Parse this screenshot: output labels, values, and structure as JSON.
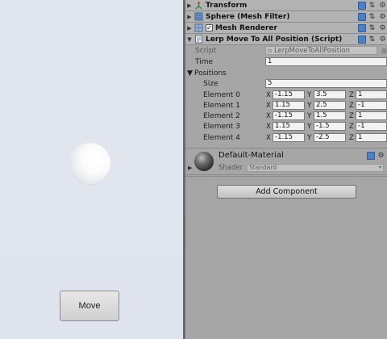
{
  "scene": {
    "move_button": "Move"
  },
  "inspector": {
    "components": [
      {
        "title": "Transform"
      },
      {
        "title": "Sphere (Mesh Filter)"
      },
      {
        "title": "Mesh Renderer",
        "enabled": true
      },
      {
        "title": "Lerp Move To All Position (Script)"
      }
    ],
    "script_component": {
      "script_label": "Script",
      "script_value": "LerpMoveToAllPosition",
      "time_label": "Time",
      "time_value": "1",
      "positions_label": "Positions",
      "size_label": "Size",
      "size_value": "5",
      "axis_labels": [
        "X",
        "Y",
        "Z"
      ],
      "elements": [
        {
          "label": "Element 0",
          "x": "-1.15",
          "y": "3.5",
          "z": "1"
        },
        {
          "label": "Element 1",
          "x": "1.15",
          "y": "2.5",
          "z": "-1"
        },
        {
          "label": "Element 2",
          "x": "-1.15",
          "y": "1.5",
          "z": "1"
        },
        {
          "label": "Element 3",
          "x": "1.15",
          "y": "-1.5",
          "z": "-1"
        },
        {
          "label": "Element 4",
          "x": "-1.15",
          "y": "-2.5",
          "z": "1"
        }
      ]
    },
    "material": {
      "name": "Default-Material",
      "shader_label": "Shader",
      "shader_value": "Standard"
    },
    "add_component_label": "Add Component"
  }
}
